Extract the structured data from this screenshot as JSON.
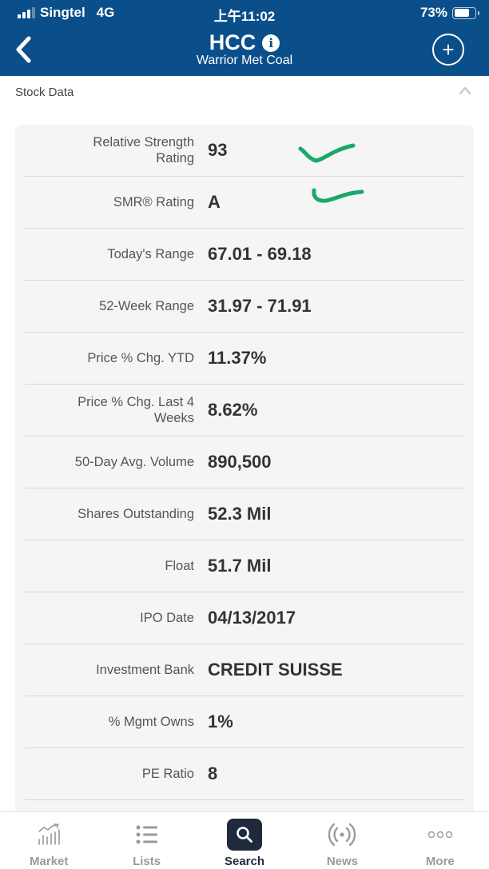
{
  "status_bar": {
    "carrier": "Singtel",
    "network": "4G",
    "time": "上午11:02",
    "battery_percent": "73%",
    "battery_level": 0.73,
    "signal_bars_active": 3,
    "signal_bars_total": 4
  },
  "header": {
    "ticker": "HCC",
    "company_name": "Warrior Met Coal",
    "info_icon": "i",
    "add_button": "+",
    "background_color": "#0b4f8a"
  },
  "section": {
    "title": "Stock Data",
    "expanded": true
  },
  "stock_data": [
    {
      "label": "Relative Strength Rating",
      "value": "93"
    },
    {
      "label": "SMR® Rating",
      "value": "A"
    },
    {
      "label": "Today's Range",
      "value": "67.01 - 69.18"
    },
    {
      "label": "52-Week Range",
      "value": "31.97 - 71.91"
    },
    {
      "label": "Price % Chg. YTD",
      "value": "11.37%"
    },
    {
      "label": "Price % Chg. Last 4 Weeks",
      "value": "8.62%"
    },
    {
      "label": "50-Day Avg. Volume",
      "value": "890,500"
    },
    {
      "label": "Shares Outstanding",
      "value": "52.3 Mil"
    },
    {
      "label": "Float",
      "value": "51.7 Mil"
    },
    {
      "label": "IPO Date",
      "value": "04/13/2017"
    },
    {
      "label": "Investment Bank",
      "value": "CREDIT SUISSE"
    },
    {
      "label": "% Mgmt Owns",
      "value": "1%"
    },
    {
      "label": "PE Ratio",
      "value": "8"
    }
  ],
  "annotation_color": "#1aa86a",
  "tabbar": {
    "active": "Search",
    "active_color": "#1f2a3c",
    "inactive_color": "#9a9a9a",
    "items": [
      {
        "label": "Market",
        "icon": "market-chart-icon"
      },
      {
        "label": "Lists",
        "icon": "list-icon"
      },
      {
        "label": "Search",
        "icon": "search-icon"
      },
      {
        "label": "News",
        "icon": "broadcast-icon"
      },
      {
        "label": "More",
        "icon": "more-dots-icon"
      }
    ]
  }
}
